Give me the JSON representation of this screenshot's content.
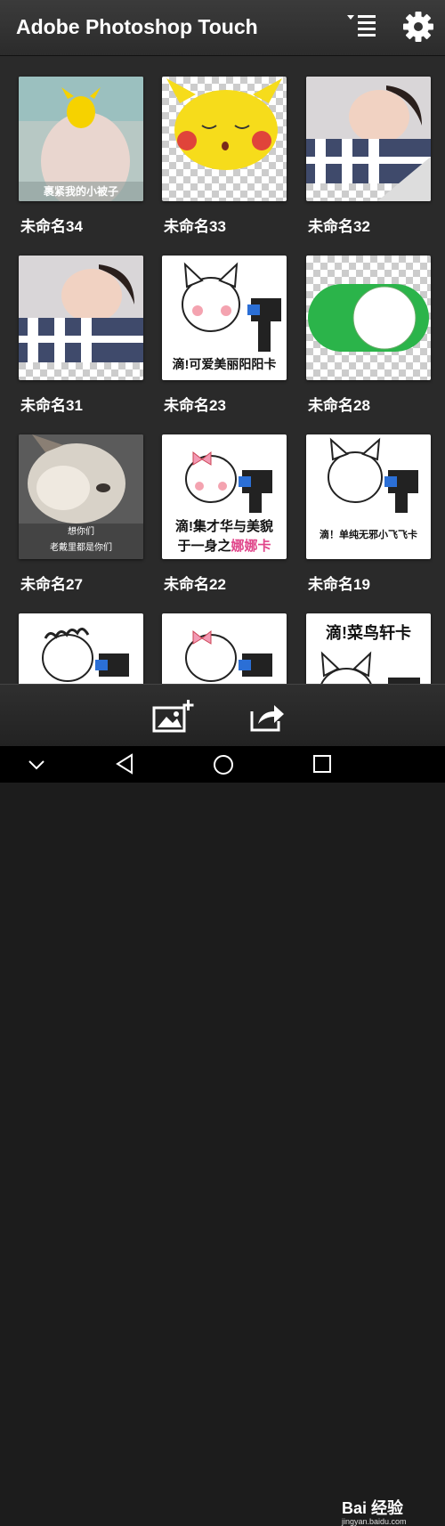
{
  "app": {
    "title": "Adobe Photoshop Touch"
  },
  "projects": [
    {
      "name": "未命名34",
      "caption": "裹紧我的小被子"
    },
    {
      "name": "未命名33",
      "caption": ""
    },
    {
      "name": "未命名32",
      "caption": ""
    },
    {
      "name": "未命名31",
      "caption": ""
    },
    {
      "name": "未命名23",
      "caption": "滴!可爱美丽阳阳卡"
    },
    {
      "name": "未命名28",
      "caption": ""
    },
    {
      "name": "未命名27",
      "caption_line1": "想你们",
      "caption_line2": "老戴里都是你们"
    },
    {
      "name": "未命名22",
      "caption_line1": "滴!集才华与美貌",
      "caption_line2a": "于一身之",
      "caption_line2b": "娜娜卡"
    },
    {
      "name": "未命名19",
      "caption": "滴！单纯无邪小飞飞卡"
    },
    {
      "name": "",
      "caption": ""
    },
    {
      "name": "",
      "caption": ""
    },
    {
      "name": "",
      "caption": "滴!菜鸟轩卡"
    }
  ],
  "watermark": {
    "brand": "Bai 经验",
    "url": "jingyan.baidu.com"
  },
  "colors": {
    "toolbar": "#333333",
    "toggle_green": "#2bb44a",
    "pink_text": "#e0458a"
  }
}
